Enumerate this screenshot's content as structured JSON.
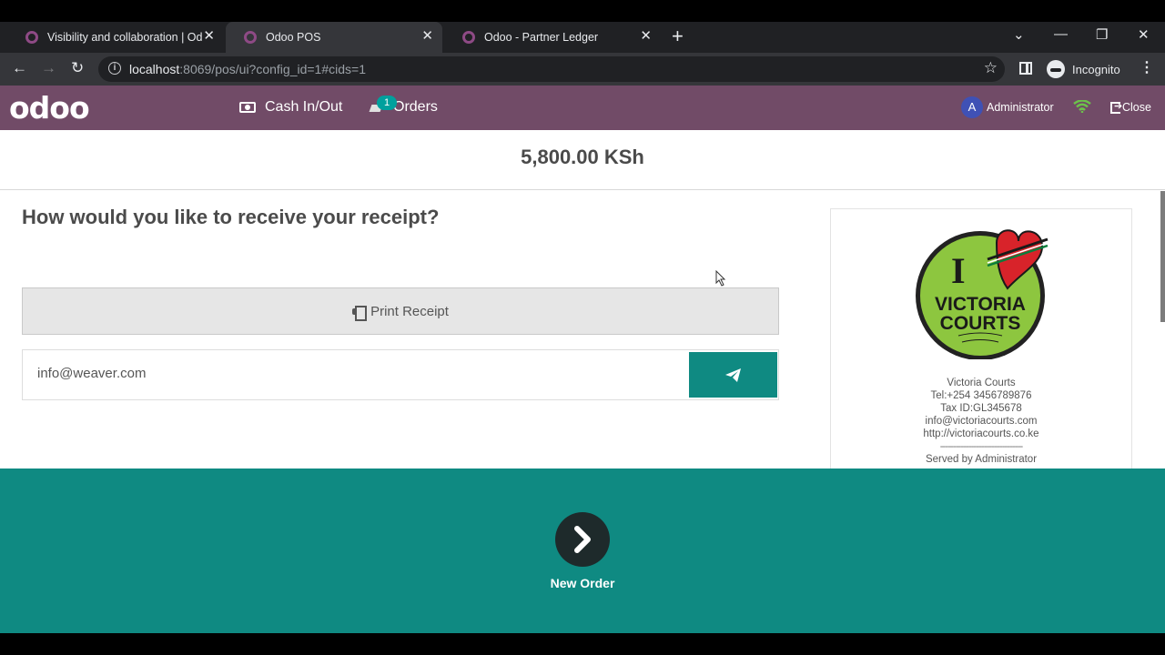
{
  "browser": {
    "tabs": [
      {
        "title": "Visibility and collaboration | Odoo",
        "active": false
      },
      {
        "title": "Odoo POS",
        "active": true
      },
      {
        "title": "Odoo - Partner Ledger",
        "active": false
      }
    ],
    "url_host": "localhost",
    "url_rest": ":8069/pos/ui?config_id=1#cids=1",
    "profile_label": "Incognito"
  },
  "pos": {
    "logo": "odoo",
    "cash_label": "Cash In/Out",
    "orders_label": "Orders",
    "orders_badge": "1",
    "user_initial": "A",
    "user_name": "Administrator",
    "close_label": "Close",
    "brand_color": "#714b67",
    "accent_color": "#0f8a82"
  },
  "payment": {
    "total": "5,800.00 KSh",
    "question": "How would you like to receive your receipt?",
    "print_label": "Print Receipt",
    "email_value": "info@weaver.com"
  },
  "receipt": {
    "logo_text_top": "VICTORIA",
    "logo_text_bottom": "COURTS",
    "logo_letter": "I",
    "company": "Victoria Courts",
    "tel": "Tel:+254 3456789876",
    "tax_id": "Tax ID:GL345678",
    "email": "info@victoriacourts.com",
    "website": "http://victoriacourts.co.ke",
    "separator": "--------------------------------",
    "served_by": "Served by Administrator"
  },
  "footer": {
    "next_label": "New Order"
  }
}
